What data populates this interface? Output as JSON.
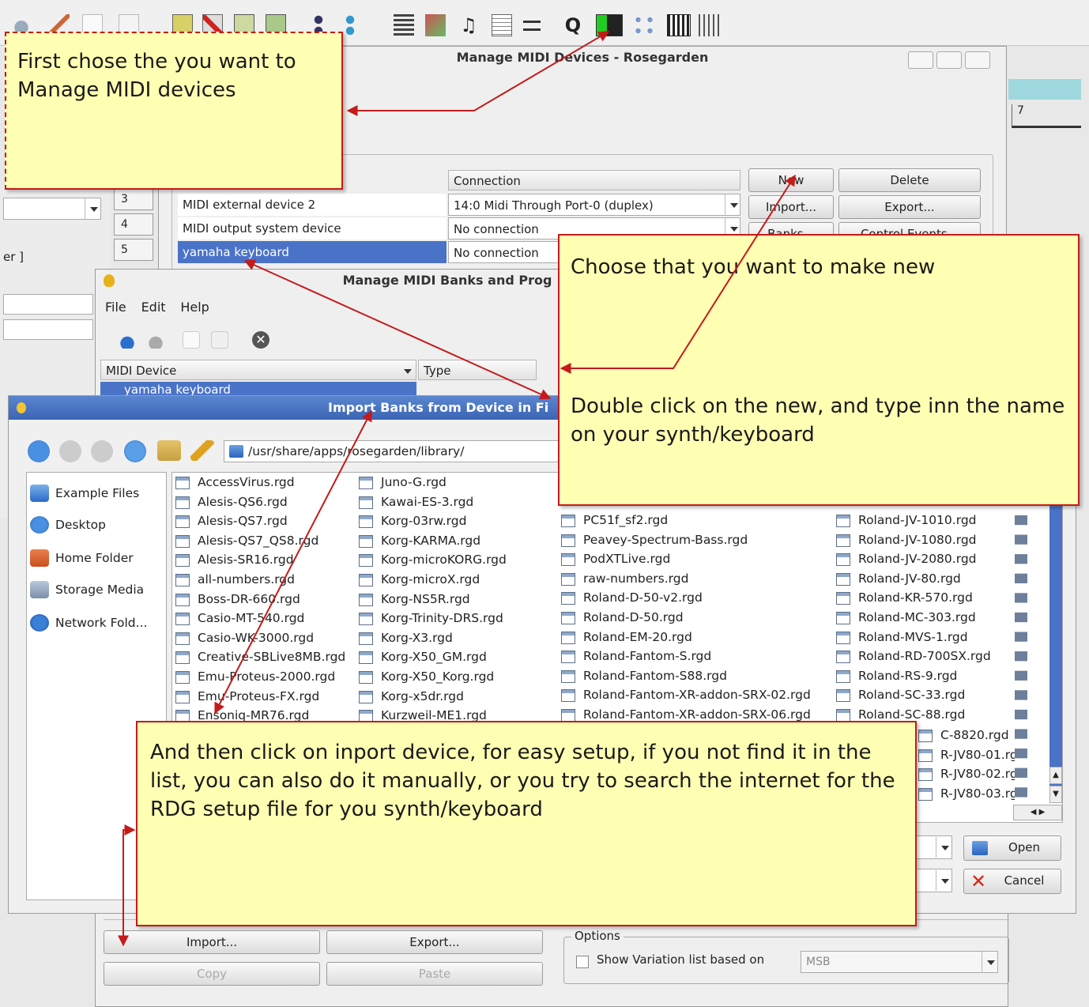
{
  "toolbar": {
    "quantize_label": "Q"
  },
  "midi_devices_window": {
    "title": "Manage MIDI Devices - Rosegarden",
    "column_connection": "Connection",
    "rows": [
      {
        "name": "MIDI external device 2",
        "connection": "14:0 Midi Through Port-0 (duplex)"
      },
      {
        "name": "MIDI output system device",
        "connection": "No connection"
      },
      {
        "name": "yamaha keyboard",
        "connection": "No connection"
      }
    ],
    "buttons": {
      "new": "New",
      "delete": "Delete",
      "import": "Import...",
      "export": "Export...",
      "banks": "Banks...",
      "control_events": "Control Events..."
    },
    "track_numbers": [
      "3",
      "4",
      "5"
    ]
  },
  "banks_window": {
    "title": "Manage MIDI Banks and Prog",
    "menu": [
      "File",
      "Edit",
      "Help"
    ],
    "col_device": "MIDI Device",
    "col_type": "Type",
    "device_row": "yamaha keyboard",
    "buttons": {
      "import": "Import...",
      "export": "Export...",
      "copy": "Copy",
      "paste": "Paste"
    },
    "options_label": "Options",
    "variation_label": "Show Variation list based on",
    "variation_value": "MSB"
  },
  "import_dialog": {
    "title": "Import Banks from Device in Fi",
    "path": "/usr/share/apps/rosegarden/library/",
    "places": [
      "Example Files",
      "Desktop",
      "Home Folder",
      "Storage Media",
      "Network Fold..."
    ],
    "files_col1": [
      "AccessVirus.rgd",
      "Alesis-QS6.rgd",
      "Alesis-QS7.rgd",
      "Alesis-QS7_QS8.rgd",
      "Alesis-SR16.rgd",
      "all-numbers.rgd",
      "Boss-DR-660.rgd",
      "Casio-MT-540.rgd",
      "Casio-WK-3000.rgd",
      "Creative-SBLive8MB.rgd",
      "Emu-Proteus-2000.rgd",
      "Emu-Proteus-FX.rgd",
      "Ensoniq-MR76.rgd"
    ],
    "files_col2": [
      "Juno-G.rgd",
      "Kawai-ES-3.rgd",
      "Korg-03rw.rgd",
      "Korg-KARMA.rgd",
      "Korg-microKORG.rgd",
      "Korg-microX.rgd",
      "Korg-NS5R.rgd",
      "Korg-Trinity-DRS.rgd",
      "Korg-X3.rgd",
      "Korg-X50_GM.rgd",
      "Korg-X50_Korg.rgd",
      "Korg-x5dr.rgd",
      "Kurzweil-ME1.rgd"
    ],
    "files_col3": [
      "PC51f_sf2.rgd",
      "Peavey-Spectrum-Bass.rgd",
      "PodXTLive.rgd",
      "raw-numbers.rgd",
      "Roland-D-50-v2.rgd",
      "Roland-D-50.rgd",
      "Roland-EM-20.rgd",
      "Roland-Fantom-S.rgd",
      "Roland-Fantom-S88.rgd",
      "Roland-Fantom-XR-addon-SRX-02.rgd",
      "Roland-Fantom-XR-addon-SRX-06.rgd"
    ],
    "files_col4": [
      "Roland-JV-1010.rgd",
      "Roland-JV-1080.rgd",
      "Roland-JV-2080.rgd",
      "Roland-JV-80.rgd",
      "Roland-KR-570.rgd",
      "Roland-MC-303.rgd",
      "Roland-MVS-1.rgd",
      "Roland-RD-700SX.rgd",
      "Roland-RS-9.rgd",
      "Roland-SC-33.rgd",
      "Roland-SC-88.rgd"
    ],
    "files_col4_tail": [
      "C-8820.rgd",
      "R-JV80-01.rgd",
      "R-JV80-02.rgd",
      "R-JV80-03.rgd"
    ],
    "open_label": "Open",
    "cancel_label": "Cancel"
  },
  "annotations": {
    "note1": "First chose the you want to Manage MIDI devices",
    "note2": "Choose that you want to make new",
    "note3": "Double click on the new, and type inn the name on your synth/keyboard",
    "note4": "And then click on inport device, for easy setup, if you not find it in the list, you can also do it manually, or you try to search the internet for the RDG setup file for you synth/keyboard"
  },
  "colors": {
    "note_bg": "#ffffb3",
    "note_border": "#c41b1b",
    "arrow": "#c41b1b",
    "selection": "#4a73c8",
    "dialog_title": "#3c64b4"
  },
  "background_fragments": {
    "bar_number": "7",
    "label_fragment": "er ]"
  }
}
